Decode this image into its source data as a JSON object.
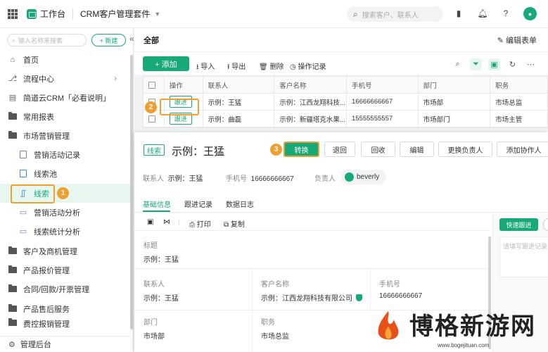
{
  "topbar": {
    "brand": "工作台",
    "app_title": "CRM客户管理套件",
    "search_placeholder": "搜索客户、联系人",
    "icons": [
      "grid-icon",
      "app-logo",
      "chevron-down-icon",
      "search-icon",
      "tablet-icon",
      "bell-icon",
      "help-icon",
      "avatar"
    ]
  },
  "sidebar": {
    "search_placeholder": "输入名称来搜索",
    "new_label": "+ 新建",
    "collapse_label": "«",
    "items": [
      {
        "label": "首页",
        "icon": "home-icon"
      },
      {
        "label": "流程中心",
        "icon": "flow-icon"
      },
      {
        "label": "简道云CRM「必看说明」",
        "icon": "doc-icon"
      },
      {
        "label": "常用报表",
        "icon": "folder-icon"
      },
      {
        "label": "市场营销管理",
        "icon": "folder-icon"
      },
      {
        "label": "营销活动记录",
        "icon": "form-icon"
      },
      {
        "label": "线索池",
        "icon": "form-icon"
      },
      {
        "label": "线索",
        "icon": "lead-icon"
      },
      {
        "label": "营销活动分析",
        "icon": "chart-icon"
      },
      {
        "label": "线索统计分析",
        "icon": "chart-icon"
      },
      {
        "label": "客户及商机管理",
        "icon": "folder-icon"
      },
      {
        "label": "产品报价管理",
        "icon": "folder-icon"
      },
      {
        "label": "合同/回款/开票管理",
        "icon": "folder-icon"
      },
      {
        "label": "产品售后服务",
        "icon": "folder-icon"
      },
      {
        "label": "费控报销管理",
        "icon": "folder-icon"
      }
    ],
    "footer": "管理后台"
  },
  "main": {
    "title": "全部",
    "edit_form": "编辑表单",
    "toolbar": {
      "add": "+ 添加",
      "import": "导入",
      "export": "导出",
      "delete": "删除",
      "log": "操作记录"
    },
    "table": {
      "columns": [
        "操作",
        "联系人",
        "客户名称",
        "手机号",
        "部门",
        "职务"
      ],
      "rows": [
        {
          "action": "跟进",
          "contact": "示例：王猛",
          "customer": "示例：江西龙翔科技...",
          "phone": "16666666667",
          "dept": "市场部",
          "title": "市场总监"
        },
        {
          "action": "跟进",
          "contact": "示例：曲磊",
          "customer": "示例：新疆塔克水果...",
          "phone": "15555555557",
          "dept": "市场部门",
          "title": "市场主管"
        }
      ]
    }
  },
  "detail": {
    "tag": "线索",
    "title": "示例：王猛",
    "buttons": [
      "转换",
      "退回",
      "回收",
      "编辑",
      "更换负责人",
      "添加协作人"
    ],
    "meta": {
      "contact_label": "联系人",
      "contact_value": "示例：王猛",
      "phone_label": "手机号",
      "phone_value": "16666666667",
      "owner_label": "负责人",
      "owner_value": "beverly"
    },
    "tabs": [
      "基础信息",
      "跟进记录",
      "数据日志"
    ],
    "subbar": {
      "print": "打印",
      "copy": "复制"
    },
    "fields": {
      "title_label": "标题",
      "title_value": "示例：王猛",
      "contact_label": "联系人",
      "contact_value": "示例：王猛",
      "customer_label": "客户名称",
      "customer_value": "示例：江西龙翔科技有限公司",
      "phone_label": "手机号",
      "phone_value": "16666666667",
      "dept_label": "部门",
      "dept_value": "市场部",
      "job_label": "职务",
      "job_value": "市场总监"
    },
    "quick_follow": "快速跟进",
    "note_placeholder": "请填写跟进记录"
  },
  "annotations": [
    "1",
    "2",
    "3"
  ],
  "watermark": {
    "text": "博格新游网",
    "url": "www.bogejituan.com"
  },
  "colors": {
    "accent": "#18a979",
    "highlight": "#f0a030"
  }
}
